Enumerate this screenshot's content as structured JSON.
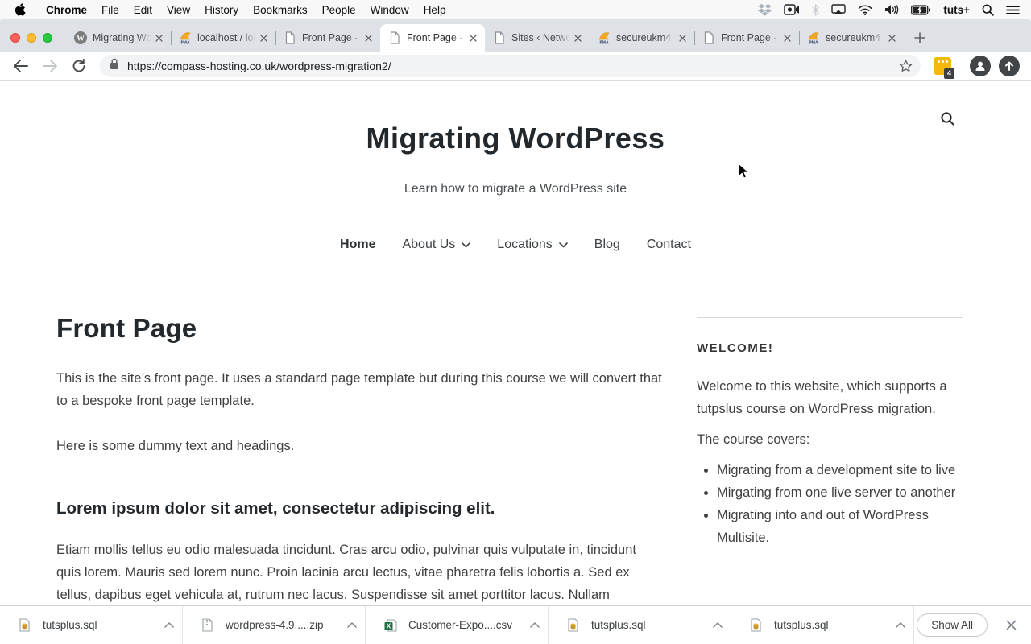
{
  "menu_bar": {
    "apple_icon": "apple-logo",
    "items": [
      {
        "label": "Chrome",
        "bold": true
      },
      {
        "label": "File"
      },
      {
        "label": "Edit"
      },
      {
        "label": "View"
      },
      {
        "label": "History"
      },
      {
        "label": "Bookmarks"
      },
      {
        "label": "People"
      },
      {
        "label": "Window"
      },
      {
        "label": "Help"
      }
    ],
    "status_icons": [
      "dropbox-icon",
      "screen-recording-icon",
      "bluetooth-icon",
      "airplay-icon",
      "wifi-icon",
      "volume-icon",
      "battery-charging-icon"
    ],
    "user_label": "tuts+",
    "right_icons": [
      "spotlight-search-icon",
      "notification-center-icon"
    ]
  },
  "browser": {
    "tabs": [
      {
        "title": "Migrating Wo",
        "favicon": "wordpress",
        "active": false
      },
      {
        "title": "localhost / loc",
        "favicon": "phpmyadmin",
        "active": false
      },
      {
        "title": "Front Page -",
        "favicon": "page",
        "active": false
      },
      {
        "title": "Front Page -",
        "favicon": "page",
        "active": true
      },
      {
        "title": "Sites ‹ Netwo",
        "favicon": "page",
        "active": false
      },
      {
        "title": "secureukm4",
        "favicon": "phpmyadmin",
        "active": false
      },
      {
        "title": "Front Page -",
        "favicon": "page",
        "active": false
      },
      {
        "title": "secureukm4",
        "favicon": "phpmyadmin",
        "active": false
      }
    ],
    "url": "https://compass-hosting.co.uk/wordpress-migration2/",
    "extension_badge": "4",
    "colors": {
      "extension": "#f5b80c",
      "tabstrip": "#dee1e6",
      "omnibox": "#f1f3f4"
    }
  },
  "page": {
    "site_title": "Migrating WordPress",
    "tagline": "Learn how to migrate a WordPress site",
    "nav_items": [
      {
        "label": "Home",
        "current": true,
        "has_submenu": false
      },
      {
        "label": "About Us",
        "current": false,
        "has_submenu": true
      },
      {
        "label": "Locations",
        "current": false,
        "has_submenu": true
      },
      {
        "label": "Blog",
        "current": false,
        "has_submenu": false
      },
      {
        "label": "Contact",
        "current": false,
        "has_submenu": false
      }
    ],
    "article": {
      "title": "Front Page",
      "p1": "This is the site’s front page. It uses a standard page template but during this course we will convert that to a bespoke front page template.",
      "p2": "Here is some dummy text and headings.",
      "h2": "Lorem ipsum dolor sit amet, consectetur adipiscing elit.",
      "p3": "Etiam mollis tellus eu odio malesuada tincidunt. Cras arcu odio, pulvinar quis vulputate in, tincidunt quis lorem. Mauris sed lorem nunc. Proin lacinia arcu lectus, vitae pharetra felis lobortis a. Sed ex tellus, dapibus eget vehicula at, rutrum nec lacus. Suspendisse sit amet porttitor lacus. Nullam"
    },
    "sidebar": {
      "heading": "WELCOME!",
      "p1": "Welcome to this website, which supports a tutpslus course on WordPress migration.",
      "p2": "The course covers:",
      "items": [
        "Migrating from a development site to live",
        "Mirgating from one live server to another",
        "Migrating into and out of WordPress Multisite."
      ]
    }
  },
  "downloads_bar": {
    "items": [
      {
        "name": "tutsplus.sql",
        "type": "sql"
      },
      {
        "name": "wordpress-4.9.....zip",
        "type": "zip"
      },
      {
        "name": "Customer-Expo....csv",
        "type": "csv"
      },
      {
        "name": "tutsplus.sql",
        "type": "sql"
      },
      {
        "name": "tutsplus.sql",
        "type": "sql"
      }
    ],
    "show_all_label": "Show All"
  }
}
